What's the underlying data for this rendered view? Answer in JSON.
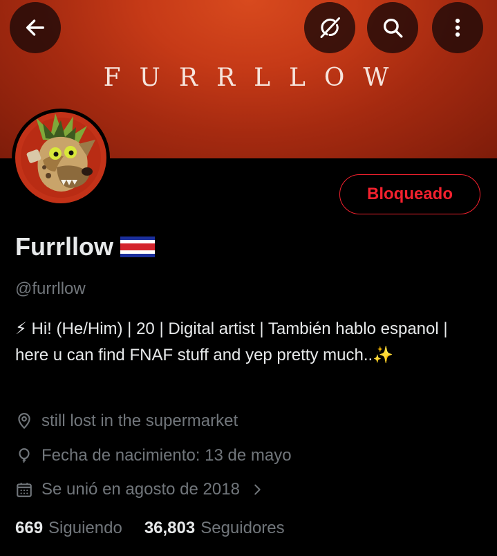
{
  "header": {
    "banner_text": "FURRLLOW",
    "back_icon": "arrow-left-icon",
    "grok_icon": "grok-icon",
    "search_icon": "search-icon",
    "more_icon": "more-vertical-icon"
  },
  "profile": {
    "display_name": "Furrllow",
    "flag": "costa-rica-flag",
    "handle": "@furrllow",
    "bio": "⚡ Hi! (He/Him) | 20 | Digital artist | También hablo espanol |   here u can find FNAF stuff and yep pretty much..✨",
    "location": "still lost in the supermarket",
    "birthday": "Fecha de nacimiento: 13 de mayo",
    "joined": "Se unió en agosto de 2018",
    "blocked_label": "Bloqueado"
  },
  "stats": {
    "following_count": "669",
    "following_label": "Siguiendo",
    "followers_count": "36,803",
    "followers_label": "Seguidores"
  },
  "colors": {
    "background": "#000000",
    "banner": "#c63a17",
    "accent_red": "#f4212e",
    "muted_text": "#71767b",
    "primary_text": "#e7e9ea"
  }
}
